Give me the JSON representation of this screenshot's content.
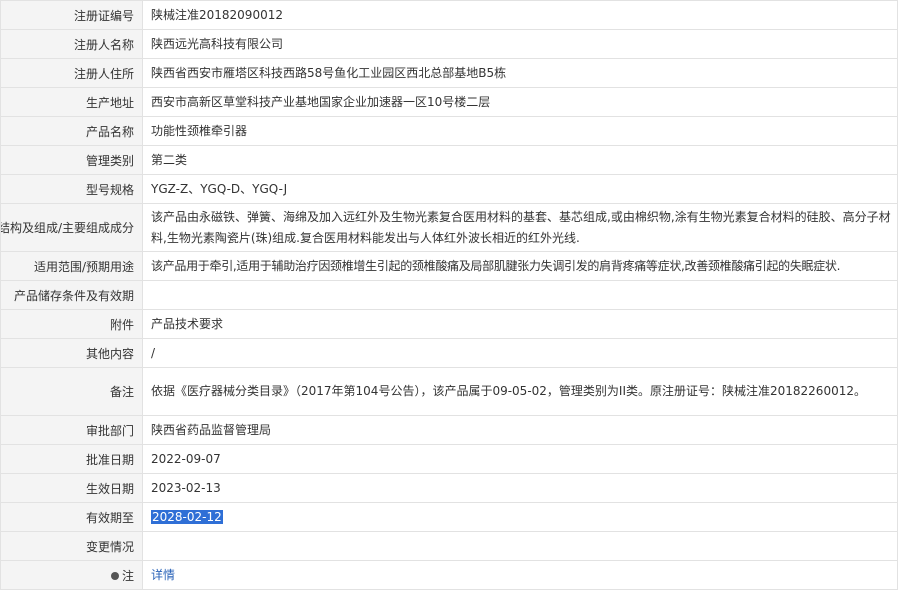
{
  "rows": [
    {
      "label": "注册证编号",
      "value": "陕械注准20182090012"
    },
    {
      "label": "注册人名称",
      "value": "陕西远光高科技有限公司"
    },
    {
      "label": "注册人住所",
      "value": "陕西省西安市雁塔区科技西路58号鱼化工业园区西北总部基地B5栋"
    },
    {
      "label": "生产地址",
      "value": "西安市高新区草堂科技产业基地国家企业加速器一区10号楼二层"
    },
    {
      "label": "产品名称",
      "value": "功能性颈椎牵引器"
    },
    {
      "label": "管理类别",
      "value": "第二类"
    },
    {
      "label": "型号规格",
      "value": "YGZ-Z、YGQ-D、YGQ-J"
    },
    {
      "label": "结构及组成/主要组成成分",
      "value": "该产品由永磁铁、弹簧、海绵及加入远红外及生物光素复合医用材料的基套、基芯组成,或由棉织物,涂有生物光素复合材料的硅胶、高分子材料,生物光素陶瓷片(珠)组成.复合医用材料能发出与人体红外波长相近的红外光线."
    },
    {
      "label": "适用范围/预期用途",
      "value": "该产品用于牵引,适用于辅助治疗因颈椎增生引起的颈椎酸痛及局部肌腱张力失调引发的肩背疼痛等症状,改善颈椎酸痛引起的失眠症状."
    },
    {
      "label": "产品储存条件及有效期",
      "value": ""
    },
    {
      "label": "附件",
      "value": "产品技术要求"
    },
    {
      "label": "其他内容",
      "value": "/"
    },
    {
      "label": "备注",
      "value": "依据《医疗器械分类目录》（2017年第104号公告），该产品属于09-05-02，管理类别为II类。原注册证号：陕械注准20182260012。"
    },
    {
      "label": "审批部门",
      "value": "陕西省药品监督管理局"
    },
    {
      "label": "批准日期",
      "value": "2022-09-07"
    },
    {
      "label": "生效日期",
      "value": "2023-02-13"
    },
    {
      "label": "有效期至",
      "value": "2028-02-12"
    },
    {
      "label": "变更情况",
      "value": ""
    },
    {
      "label": "注",
      "value": "详情",
      "icon": "note-icon"
    }
  ]
}
